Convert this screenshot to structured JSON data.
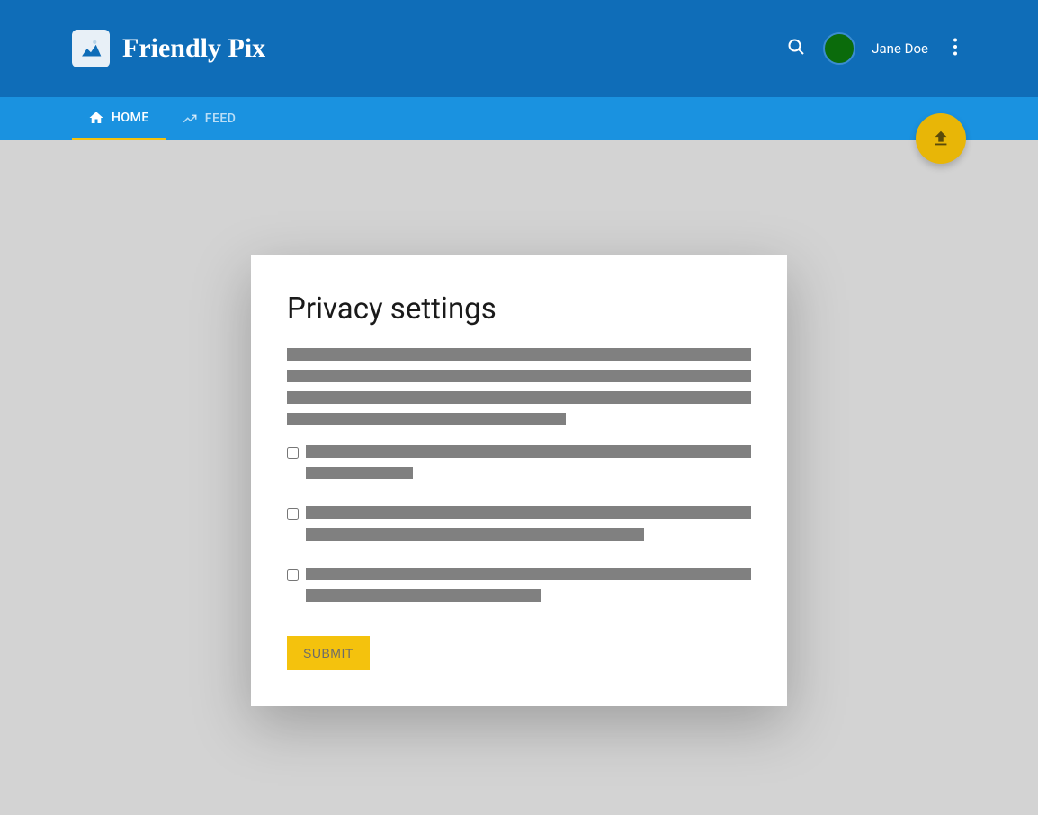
{
  "header": {
    "app_title": "Friendly Pix",
    "username": "Jane Doe"
  },
  "tabs": {
    "home": "HOME",
    "feed": "FEED"
  },
  "card": {
    "title": "Privacy settings",
    "submit_label": "SUBMIT"
  },
  "checkboxes": [
    {
      "checked": false
    },
    {
      "checked": false
    },
    {
      "checked": false
    }
  ]
}
